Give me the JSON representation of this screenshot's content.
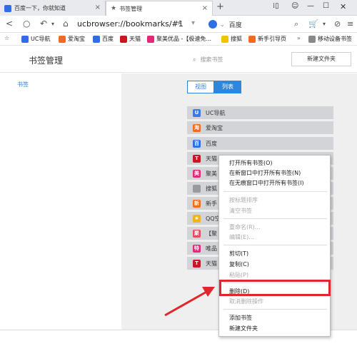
{
  "tabs": [
    {
      "label": "百度一下，你就知道"
    },
    {
      "label": "书签管理"
    }
  ],
  "address": {
    "url": "ucbrowser://bookmarks/#1",
    "search_engine": "百度"
  },
  "bookmarks_bar": [
    {
      "label": "UC导航",
      "color": "#2f6ee8"
    },
    {
      "label": "爱淘宝",
      "color": "#f56a1e"
    },
    {
      "label": "百度",
      "color": "#2f6ee8"
    },
    {
      "label": "天猫",
      "color": "#c81623"
    },
    {
      "label": "聚美优品 -【极速免...",
      "color": "#e5277a"
    },
    {
      "label": "搜狐",
      "color": "#f2c400"
    },
    {
      "label": "新手引导页",
      "color": "#f56a1e"
    },
    {
      "label": "移动设备书签",
      "color": "#888888"
    }
  ],
  "page": {
    "title": "书签管理",
    "search_placeholder": "搜索书签",
    "new_folder": "新建文件夹"
  },
  "sidebar": {
    "item": "书签"
  },
  "view_toggle": {
    "view": "视图",
    "list": "列表"
  },
  "rows": [
    {
      "label": "UC导航",
      "icon": "uc-icon",
      "color": "#3b7ae0",
      "glyph": "U"
    },
    {
      "label": "爱淘宝",
      "icon": "taobao-icon",
      "color": "#f56a1e",
      "glyph": "淘"
    },
    {
      "label": "百度",
      "icon": "baidu-icon",
      "color": "#2f6ee8",
      "glyph": "百"
    },
    {
      "label": "天猫",
      "icon": "tmall-icon",
      "color": "#c81623",
      "glyph": "T"
    },
    {
      "label": "聚美",
      "icon": "jumei-icon",
      "color": "#e5277a",
      "glyph": "美"
    },
    {
      "label": "搜狐",
      "icon": "file-icon",
      "color": "#9a9a9a",
      "glyph": ""
    },
    {
      "label": "新手",
      "icon": "guide-icon",
      "color": "#f56a1e",
      "glyph": "新"
    },
    {
      "label": "QQ空",
      "icon": "qq-star-icon",
      "color": "#f2b21c",
      "glyph": "★"
    },
    {
      "label": "【聚",
      "icon": "jumei2-icon",
      "color": "#e84b57",
      "glyph": "聚"
    },
    {
      "label": "唯品",
      "icon": "vip-icon",
      "color": "#e5277a",
      "glyph": "特"
    },
    {
      "label": "天猫",
      "icon": "tmall2-icon",
      "color": "#c81623",
      "glyph": "T"
    }
  ],
  "context_menu": {
    "open_all": "打开所有书签(O)",
    "open_all_new_window": "在新窗口中打开所有书签(N)",
    "open_all_incognito": "在无痕窗口中打开所有书签(I)",
    "sort_by_title": "按标题排序",
    "clear": "清空书签",
    "rename": "重命名(R)...",
    "edit": "编辑(E)...",
    "cut": "剪切(T)",
    "copy": "复制(C)",
    "paste": "粘贴(P)",
    "delete": "删除(D)",
    "undo_delete": "取消删除操作",
    "add_bookmark": "添加书签",
    "new_folder": "新建文件夹"
  }
}
